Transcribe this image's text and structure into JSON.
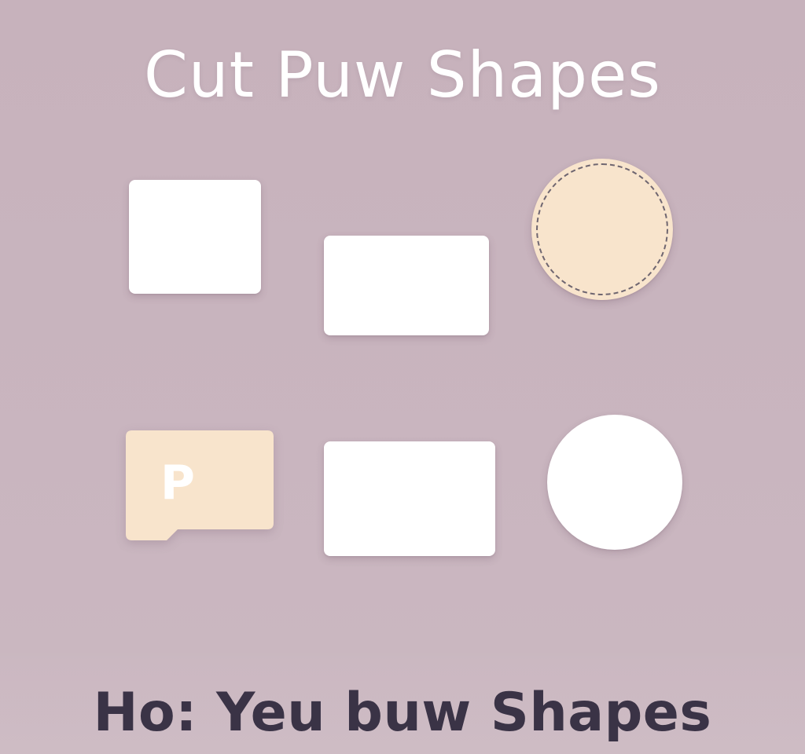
{
  "title": "Cut Puw Shapes",
  "subtitle": "Ho: Yeu buw Shapes",
  "shapes": {
    "tag_letter": "P"
  },
  "colors": {
    "background": "#c8b4be",
    "title_text": "#ffffff",
    "subtitle_text": "#3a3346",
    "white_shape": "#ffffff",
    "cream_shape": "#f8e4cc",
    "dashed_line": "#6f6670"
  }
}
